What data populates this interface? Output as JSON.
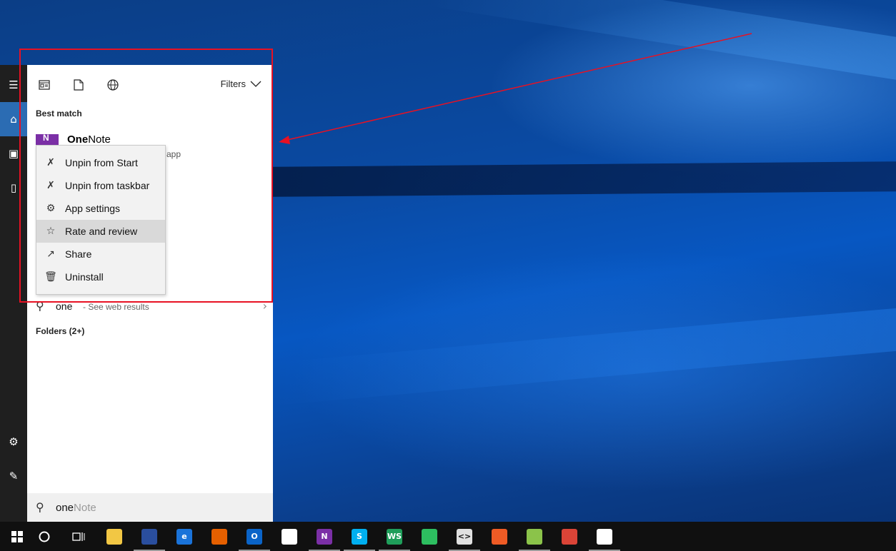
{
  "panel": {
    "filters_label": "Filters",
    "best_match_label": "Best match",
    "app": {
      "name_bold": "One",
      "name_rest": "Note",
      "subtitle": "app"
    },
    "web": {
      "query": "one",
      "desc": "- See web results"
    },
    "folders_label": "Folders (2+)",
    "search": {
      "typed": "one",
      "hint": "Note"
    }
  },
  "context_menu": {
    "items": [
      {
        "label": "Unpin from Start",
        "icon": "unpin-icon"
      },
      {
        "label": "Unpin from taskbar",
        "icon": "unpin-icon"
      },
      {
        "label": "App settings",
        "icon": "gear-icon"
      },
      {
        "label": "Rate and review",
        "icon": "rate-icon"
      },
      {
        "label": "Share",
        "icon": "share-icon"
      },
      {
        "label": "Uninstall",
        "icon": "trash-icon"
      }
    ],
    "highlighted_index": 3
  },
  "taskbar": {
    "icons": [
      {
        "name": "file-explorer",
        "color": "#f2c744",
        "glyph": ""
      },
      {
        "name": "save",
        "color": "#2a4e9e",
        "glyph": ""
      },
      {
        "name": "edge",
        "color": "#1a73d9",
        "glyph": "e"
      },
      {
        "name": "firefox",
        "color": "#e66000",
        "glyph": ""
      },
      {
        "name": "outlook",
        "color": "#0a64c8",
        "glyph": "O"
      },
      {
        "name": "slack",
        "color": "#ffffff",
        "glyph": ""
      },
      {
        "name": "onenote",
        "color": "#7b2fa6",
        "glyph": "N"
      },
      {
        "name": "skype",
        "color": "#00aff0",
        "glyph": "S"
      },
      {
        "name": "webstorm",
        "color": "#1f9e5a",
        "glyph": "WS"
      },
      {
        "name": "evernote",
        "color": "#2dbe60",
        "glyph": ""
      },
      {
        "name": "code-editor",
        "color": "#e0e0e0",
        "glyph": "<>"
      },
      {
        "name": "postman",
        "color": "#ef5b25",
        "glyph": ""
      },
      {
        "name": "notepad-plus",
        "color": "#8bc34a",
        "glyph": ""
      },
      {
        "name": "chrome",
        "color": "#db4437",
        "glyph": ""
      },
      {
        "name": "calculator",
        "color": "#ffffff",
        "glyph": ""
      }
    ]
  },
  "colors": {
    "accent": "#2b6cb3",
    "annotation": "#e81123"
  }
}
